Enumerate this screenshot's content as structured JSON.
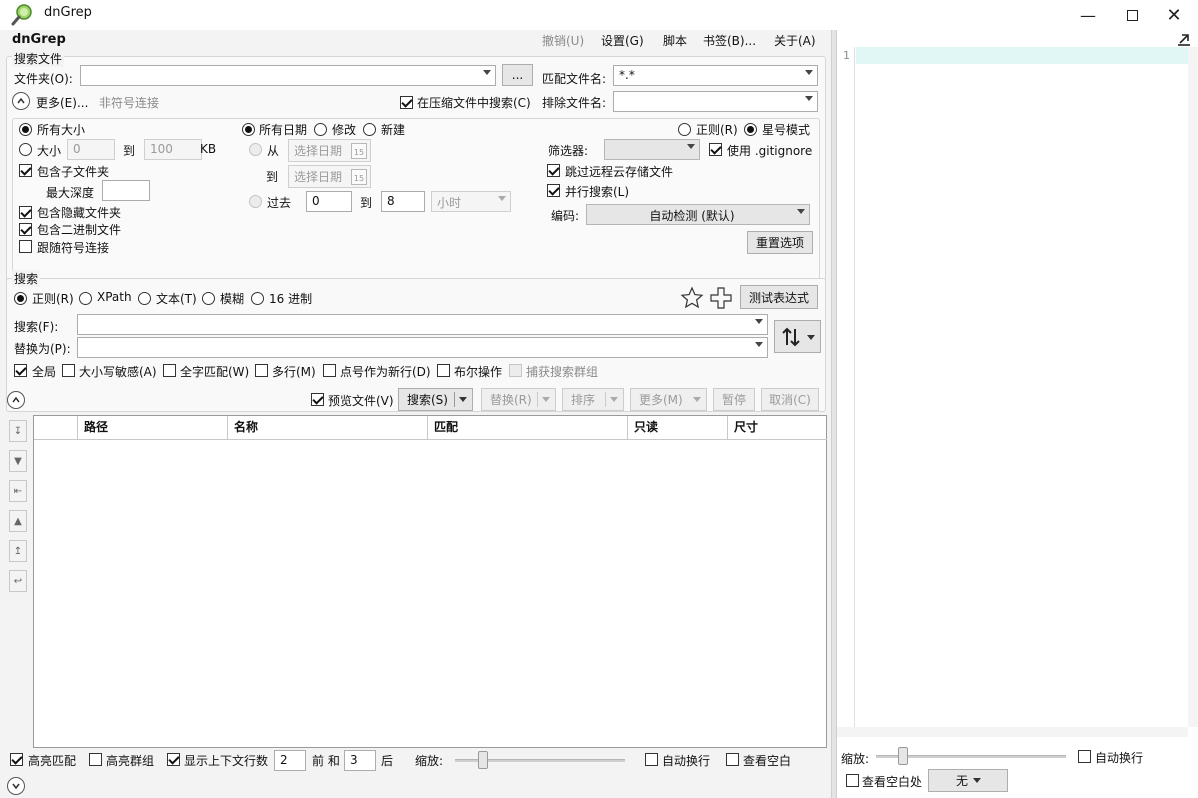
{
  "window": {
    "title": "dnGrep"
  },
  "menu": {
    "app_name": "dnGrep",
    "items": [
      "撤销(U)",
      "设置(G)",
      "脚本",
      "书签(B)...",
      "关于(A)"
    ]
  },
  "search_files": {
    "title": "搜索文件",
    "folder_label": "文件夹(O):",
    "folder_value": "",
    "browse_label": "...",
    "match_filename_label": "匹配文件名:",
    "match_filename_value": "*.*",
    "more_label": "更多(E)...",
    "no_symlink_label": "非符号连接",
    "search_archives_label": "在压缩文件中搜索(C)",
    "exclude_filename_label": "排除文件名:",
    "exclude_filename_value": ""
  },
  "options": {
    "all_sizes": "所有大小",
    "size": "大小",
    "size_from": "0",
    "size_to_label": "到",
    "size_to": "100",
    "size_unit": "KB",
    "include_subfolders": "包含子文件夹",
    "max_depth": "最大深度",
    "max_depth_value": "",
    "include_hidden": "包含隐藏文件夹",
    "include_binary": "包含二进制文件",
    "follow_symlinks": "跟随符号连接",
    "all_dates": "所有日期",
    "modified": "修改",
    "created": "新建",
    "from_label": "从",
    "pick_date": "选择日期",
    "date_to_label": "到",
    "past_label": "过去",
    "past_from": "0",
    "past_to_label": "到",
    "past_to": "8",
    "hours": "小时",
    "regex_mode": "正则(R)",
    "wildcard_mode": "星号模式",
    "filter_label": "筛选器:",
    "filter_value": "",
    "use_gitignore": "使用 .gitignore",
    "skip_cloud": "跳过远程云存储文件",
    "parallel_search": "并行搜索(L)",
    "encoding_label": "编码:",
    "encoding_value": "自动检测 (默认)",
    "reset_options": "重置选项"
  },
  "search": {
    "title": "搜索",
    "types": [
      "正则(R)",
      "XPath",
      "文本(T)",
      "模糊",
      "16 进制"
    ],
    "test_expression": "测试表达式",
    "search_label": "搜索(F):",
    "search_value": "",
    "replace_label": "替换为(P):",
    "replace_value": "",
    "flags": [
      "全局",
      "大小写敏感(A)",
      "全字匹配(W)",
      "多行(M)",
      "点号作为新行(D)",
      "布尔操作",
      "捕获搜索群组"
    ]
  },
  "actions": {
    "preview_file": "预览文件(V)",
    "search_btn": "搜索(S)",
    "replace_btn": "替换(R)",
    "sort_btn": "排序",
    "more_btn": "更多(M)",
    "pause_btn": "暂停",
    "cancel_btn": "取消(C)"
  },
  "results": {
    "columns": [
      "路径",
      "名称",
      "匹配",
      "只读",
      "尺寸"
    ],
    "rows": []
  },
  "bottom": {
    "highlight_matches": "高亮匹配",
    "highlight_groups": "高亮群组",
    "show_context": "显示上下文行数",
    "before_value": "2",
    "before_label": "前 和",
    "after_value": "3",
    "after_label": "后",
    "zoom_label": "缩放:",
    "word_wrap": "自动换行",
    "view_whitespace": "查看空白"
  },
  "preview": {
    "line_number": "1",
    "zoom_label": "缩放:",
    "word_wrap": "自动换行",
    "view_whitespace": "查看空白处",
    "syntax_value": "无"
  },
  "colors": {
    "current_line": "#e0f7f5",
    "panel_bg": "#f3f3f3",
    "group_border": "#d6d6d6"
  }
}
